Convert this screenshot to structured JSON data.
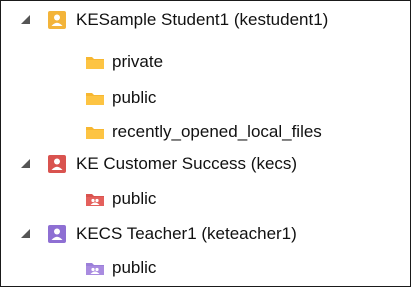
{
  "tree": {
    "users": [
      {
        "label": "KESample Student1 (kestudent1)",
        "icon": "user-icon",
        "color": "#f3b43a",
        "folders": [
          {
            "label": "private",
            "icon": "folder-icon",
            "color": "#f7b731"
          },
          {
            "label": "public",
            "icon": "folder-icon",
            "color": "#f7b731"
          },
          {
            "label": "recently_opened_local_files",
            "icon": "folder-icon",
            "color": "#f7b731"
          }
        ]
      },
      {
        "label": "KE Customer Success (kecs)",
        "icon": "user-icon",
        "color": "#d9534f",
        "folders": [
          {
            "label": "public",
            "icon": "shared-folder-icon",
            "color": "#d9534f"
          }
        ]
      },
      {
        "label": "KECS Teacher1 (keteacher1)",
        "icon": "user-icon",
        "color": "#8e6fd3",
        "folders": [
          {
            "label": "public",
            "icon": "shared-folder-icon",
            "color": "#9b7fd9"
          }
        ]
      }
    ]
  }
}
